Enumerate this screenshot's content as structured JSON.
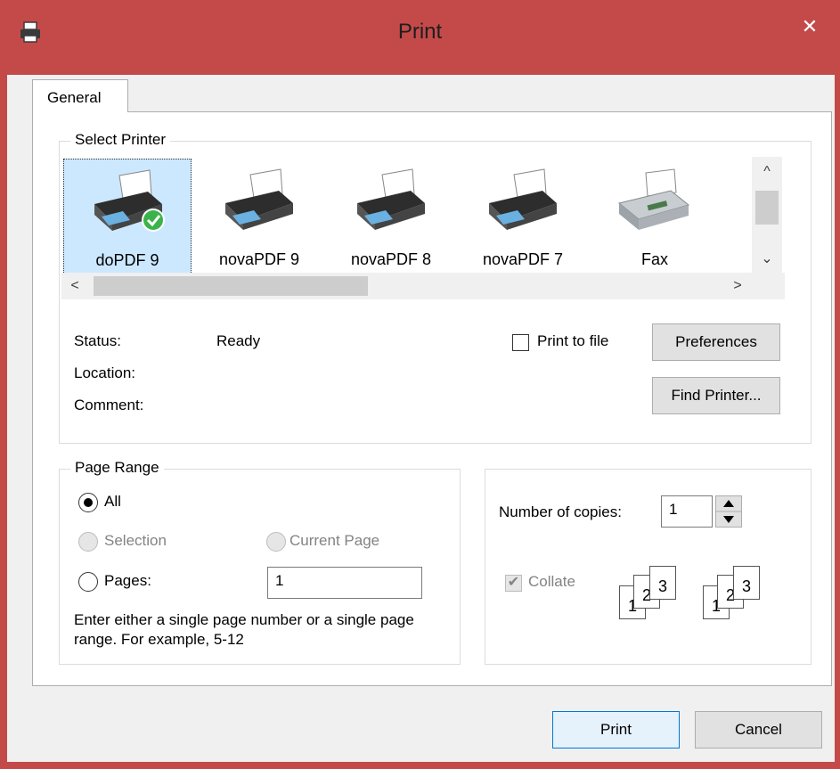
{
  "window": {
    "title": "Print",
    "close_glyph": "✕",
    "accent": "#c44a4a"
  },
  "tabs": [
    {
      "label": "General"
    }
  ],
  "select_printer": {
    "legend": "Select Printer",
    "printers": [
      {
        "name": "doPDF 9",
        "icon": "printer-icon",
        "default": true,
        "selected": true
      },
      {
        "name": "novaPDF 9",
        "icon": "printer-icon"
      },
      {
        "name": "novaPDF 8",
        "icon": "printer-icon"
      },
      {
        "name": "novaPDF 7",
        "icon": "printer-icon"
      },
      {
        "name": "Fax",
        "icon": "fax-icon"
      }
    ],
    "status_label": "Status:",
    "status_value": "Ready",
    "location_label": "Location:",
    "comment_label": "Comment:",
    "print_to_file_label": "Print to file",
    "print_to_file_checked": false,
    "preferences_label": "Preferences",
    "find_printer_label": "Find Printer..."
  },
  "page_range": {
    "legend": "Page Range",
    "all_label": "All",
    "selection_label": "Selection",
    "current_page_label": "Current Page",
    "pages_label": "Pages:",
    "pages_value": "1",
    "selected_option": "All",
    "hint": "Enter either a single page number or a single page range.  For example, 5-12"
  },
  "copies": {
    "number_label": "Number of copies:",
    "number_value": "1",
    "collate_label": "Collate",
    "collate_checked": true,
    "collate_pages": [
      "1",
      "2",
      "3"
    ]
  },
  "footer": {
    "print_label": "Print",
    "cancel_label": "Cancel"
  }
}
